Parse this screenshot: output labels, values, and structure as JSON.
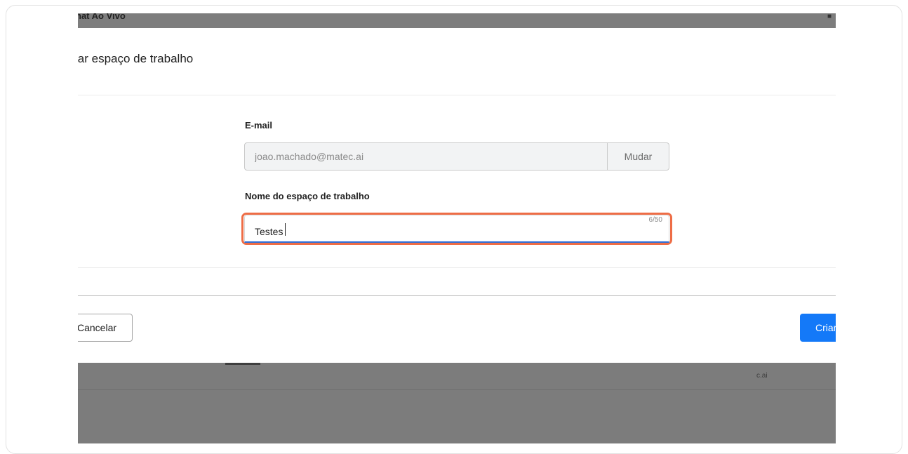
{
  "topbar": {
    "title": "hat Ao Vivo",
    "bell_icon": "bell-icon"
  },
  "modal": {
    "title": "iar espaço de trabalho"
  },
  "form": {
    "email_label": "E-mail",
    "email_value": "joao.machado@matec.ai",
    "change_button": "Mudar",
    "workspace_label": "Nome do espaço de trabalho",
    "workspace_value": "Testes",
    "counter": "6/50"
  },
  "footer": {
    "cancel": "Cancelar",
    "create": "Criar"
  },
  "background": {
    "text": "c.ai"
  },
  "colors": {
    "focus_ring": "#ee6d46",
    "primary": "#1479f8",
    "input_underline": "#2e6fd8"
  }
}
